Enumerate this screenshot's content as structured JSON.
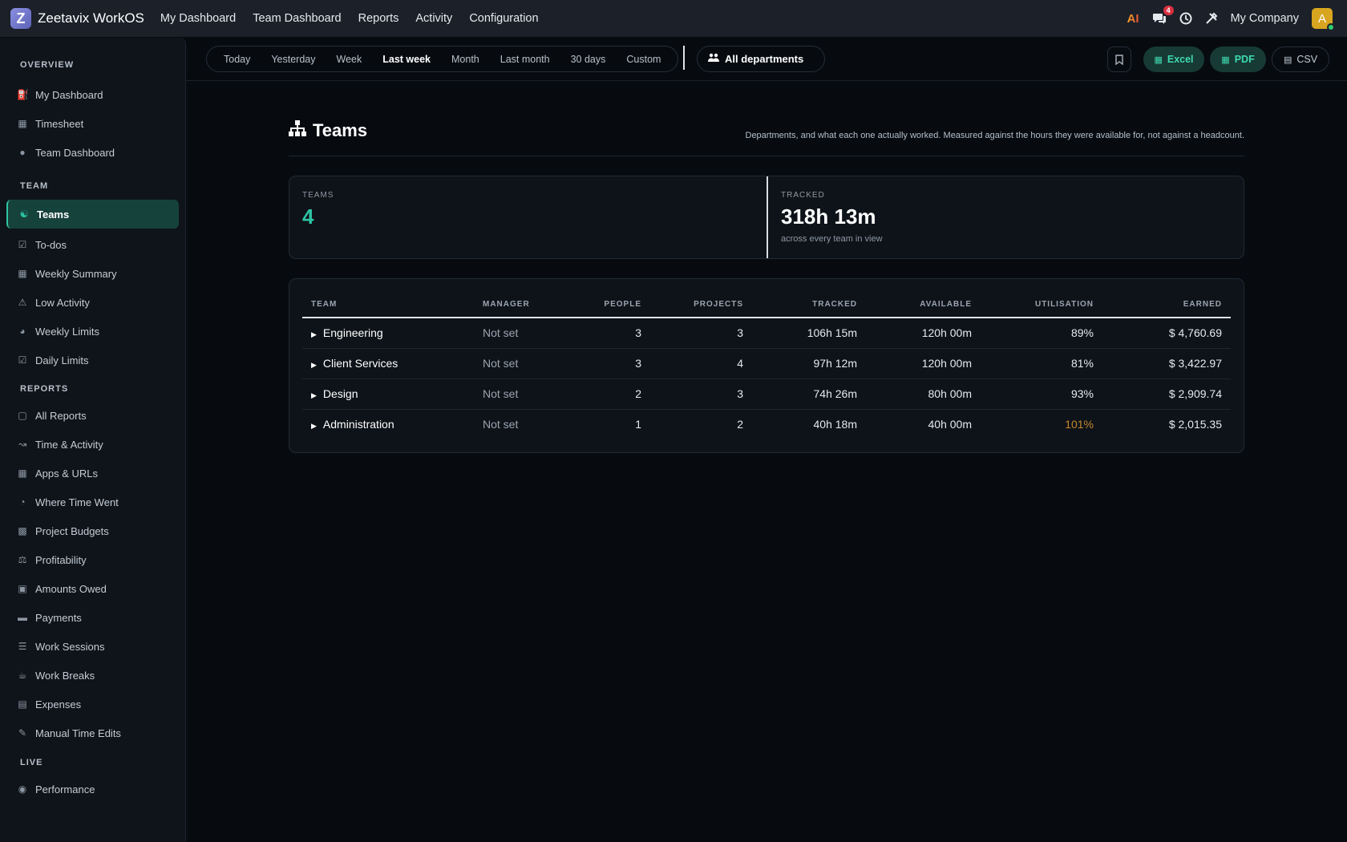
{
  "topbar": {
    "logo_letter": "Z",
    "brand": "Zeetavix WorkOS",
    "nav": [
      "My Dashboard",
      "Team Dashboard",
      "Reports",
      "Activity",
      "Configuration"
    ],
    "ai_label": "AI",
    "chat_badge": "4",
    "company": "My Company",
    "avatar_letter": "A"
  },
  "sidebar": {
    "sections": [
      {
        "label": "OVERVIEW",
        "items": [
          {
            "label": "My Dashboard",
            "icon": "lock-icon"
          },
          {
            "label": "Timesheet",
            "icon": "calendar-icon"
          },
          {
            "label": "Team Dashboard",
            "icon": "users-icon"
          }
        ]
      },
      {
        "label": "TEAM",
        "items": [
          {
            "label": "Teams",
            "icon": "sitemap-icon",
            "active": true
          },
          {
            "label": "To-dos",
            "icon": "checkbox-icon"
          },
          {
            "label": "Weekly Summary",
            "icon": "table-icon"
          },
          {
            "label": "Low Activity",
            "icon": "warning-icon"
          },
          {
            "label": "Weekly Limits",
            "icon": "gauge-icon"
          },
          {
            "label": "Daily Limits",
            "icon": "calendar-check-icon"
          }
        ]
      },
      {
        "label": "REPORTS",
        "items": [
          {
            "label": "All Reports",
            "icon": "folder-icon"
          },
          {
            "label": "Time & Activity",
            "icon": "line-chart-icon"
          },
          {
            "label": "Apps & URLs",
            "icon": "grid-icon"
          },
          {
            "label": "Where Time Went",
            "icon": "pie-chart-icon"
          },
          {
            "label": "Project Budgets",
            "icon": "briefcase-icon"
          },
          {
            "label": "Profitability",
            "icon": "scale-icon"
          },
          {
            "label": "Amounts Owed",
            "icon": "money-icon"
          },
          {
            "label": "Payments",
            "icon": "credit-card-icon"
          },
          {
            "label": "Work Sessions",
            "icon": "list-icon"
          },
          {
            "label": "Work Breaks",
            "icon": "coffee-icon"
          },
          {
            "label": "Expenses",
            "icon": "receipt-icon"
          },
          {
            "label": "Manual Time Edits",
            "icon": "edit-icon"
          }
        ]
      },
      {
        "label": "LIVE",
        "items": [
          {
            "label": "Performance",
            "icon": "target-icon"
          }
        ]
      }
    ]
  },
  "toolbar": {
    "ranges": [
      "Today",
      "Yesterday",
      "Week",
      "Last week",
      "Month",
      "Last month",
      "30 days",
      "Custom"
    ],
    "active_range": "Last week",
    "department": "All departments",
    "exports": {
      "excel": "Excel",
      "pdf": "PDF",
      "csv": "CSV"
    }
  },
  "page": {
    "title": "Teams",
    "subtitle": "Departments, and what each one actually worked. Measured against the hours they were available for, not against a headcount."
  },
  "stats": {
    "teams_label": "TEAMS",
    "teams_value": "4",
    "tracked_label": "TRACKED",
    "tracked_value": "318h 13m",
    "tracked_note": "across every team in view"
  },
  "table": {
    "headers": [
      "TEAM",
      "MANAGER",
      "PEOPLE",
      "PROJECTS",
      "TRACKED",
      "AVAILABLE",
      "UTILISATION",
      "EARNED"
    ],
    "rows": [
      {
        "team": "Engineering",
        "manager": "Not set",
        "people": "3",
        "projects": "3",
        "tracked": "106h 15m",
        "available": "120h 00m",
        "utilisation": "89%",
        "earned": "$ 4,760.69"
      },
      {
        "team": "Client Services",
        "manager": "Not set",
        "people": "3",
        "projects": "4",
        "tracked": "97h 12m",
        "available": "120h 00m",
        "utilisation": "81%",
        "earned": "$ 3,422.97"
      },
      {
        "team": "Design",
        "manager": "Not set",
        "people": "2",
        "projects": "3",
        "tracked": "74h 26m",
        "available": "80h 00m",
        "utilisation": "93%",
        "earned": "$ 2,909.74"
      },
      {
        "team": "Administration",
        "manager": "Not set",
        "people": "1",
        "projects": "2",
        "tracked": "40h 18m",
        "available": "40h 00m",
        "utilisation": "101%",
        "earned": "$ 2,015.35",
        "over": true
      }
    ]
  },
  "colors": {
    "accent": "#2ec4a4",
    "warning": "#c5862e",
    "badge": "#d93040"
  }
}
